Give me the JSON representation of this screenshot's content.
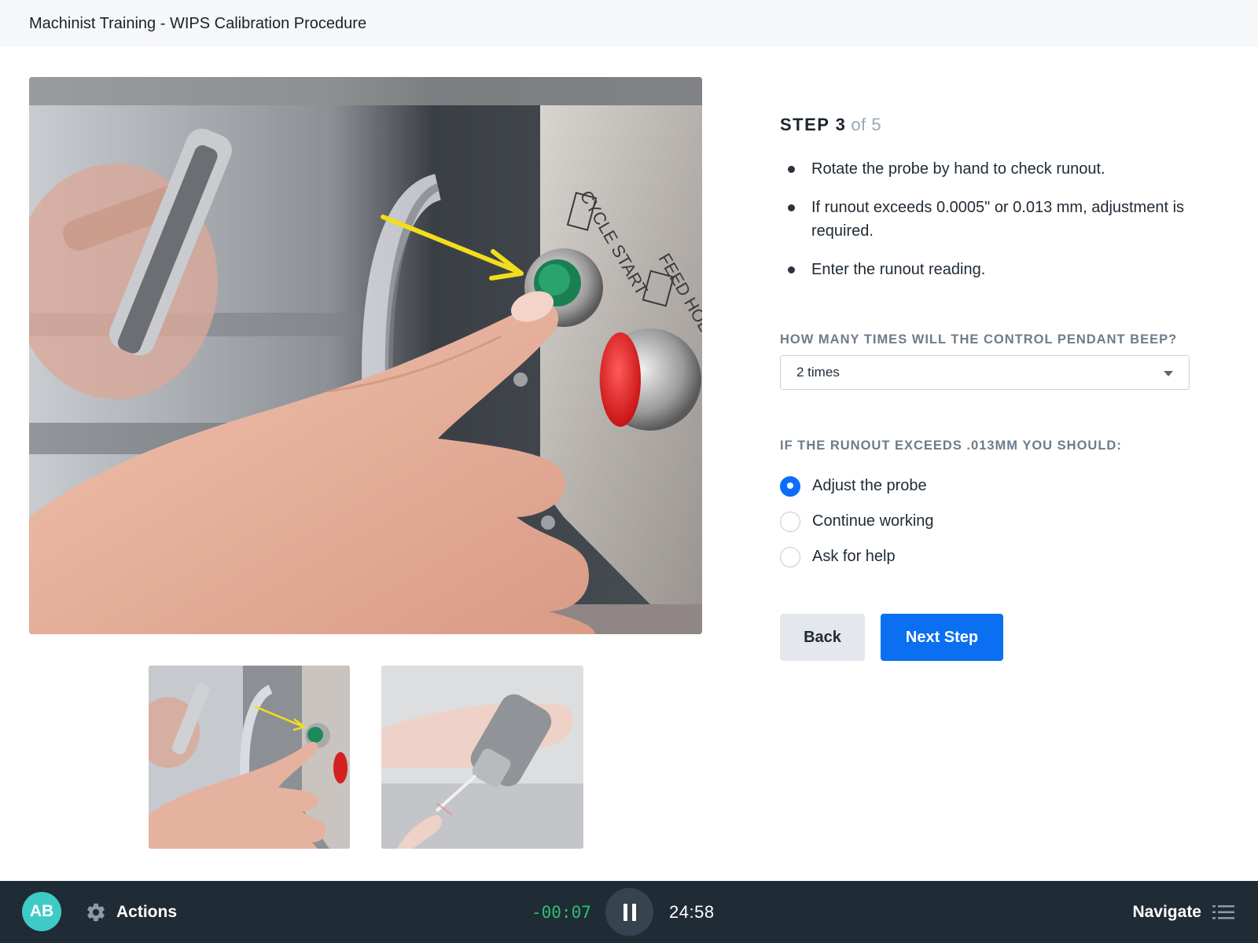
{
  "header": {
    "title": "Machinist Training - WIPS Calibration Procedure"
  },
  "step": {
    "label": "STEP 3",
    "of_label": "of 5",
    "instructions": [
      "Rotate the probe by hand to check runout.",
      "If runout exceeds 0.0005\" or 0.013 mm, adjustment is required.",
      "Enter the runout reading."
    ]
  },
  "question1": {
    "label": "HOW MANY TIMES WILL THE CONTROL PENDANT BEEP?",
    "selected": "2 times"
  },
  "question2": {
    "label": "IF THE RUNOUT EXCEEDS .013MM YOU SHOULD:",
    "options": [
      "Adjust the probe",
      "Continue working",
      "Ask for help"
    ],
    "selected_index": 0
  },
  "buttons": {
    "back": "Back",
    "next": "Next Step"
  },
  "images": {
    "main": "cycle-start-button-photo",
    "thumbnails": [
      "cycle-start-button-photo",
      "probe-in-hand-photo"
    ]
  },
  "footer": {
    "avatar_initials": "AB",
    "actions_label": "Actions",
    "step_timer": "-00:07",
    "total_timer": "24:58",
    "navigate_label": "Navigate"
  },
  "colors": {
    "accent": "#0a6ff0",
    "timer_green": "#2dbf6e",
    "avatar": "#3ecbc6",
    "footer_bg": "#1f2b35",
    "arrow_annotation": "#f2de1c"
  },
  "icons": [
    "gear-icon",
    "pause-icon",
    "list-icon",
    "chevron-down-icon"
  ]
}
